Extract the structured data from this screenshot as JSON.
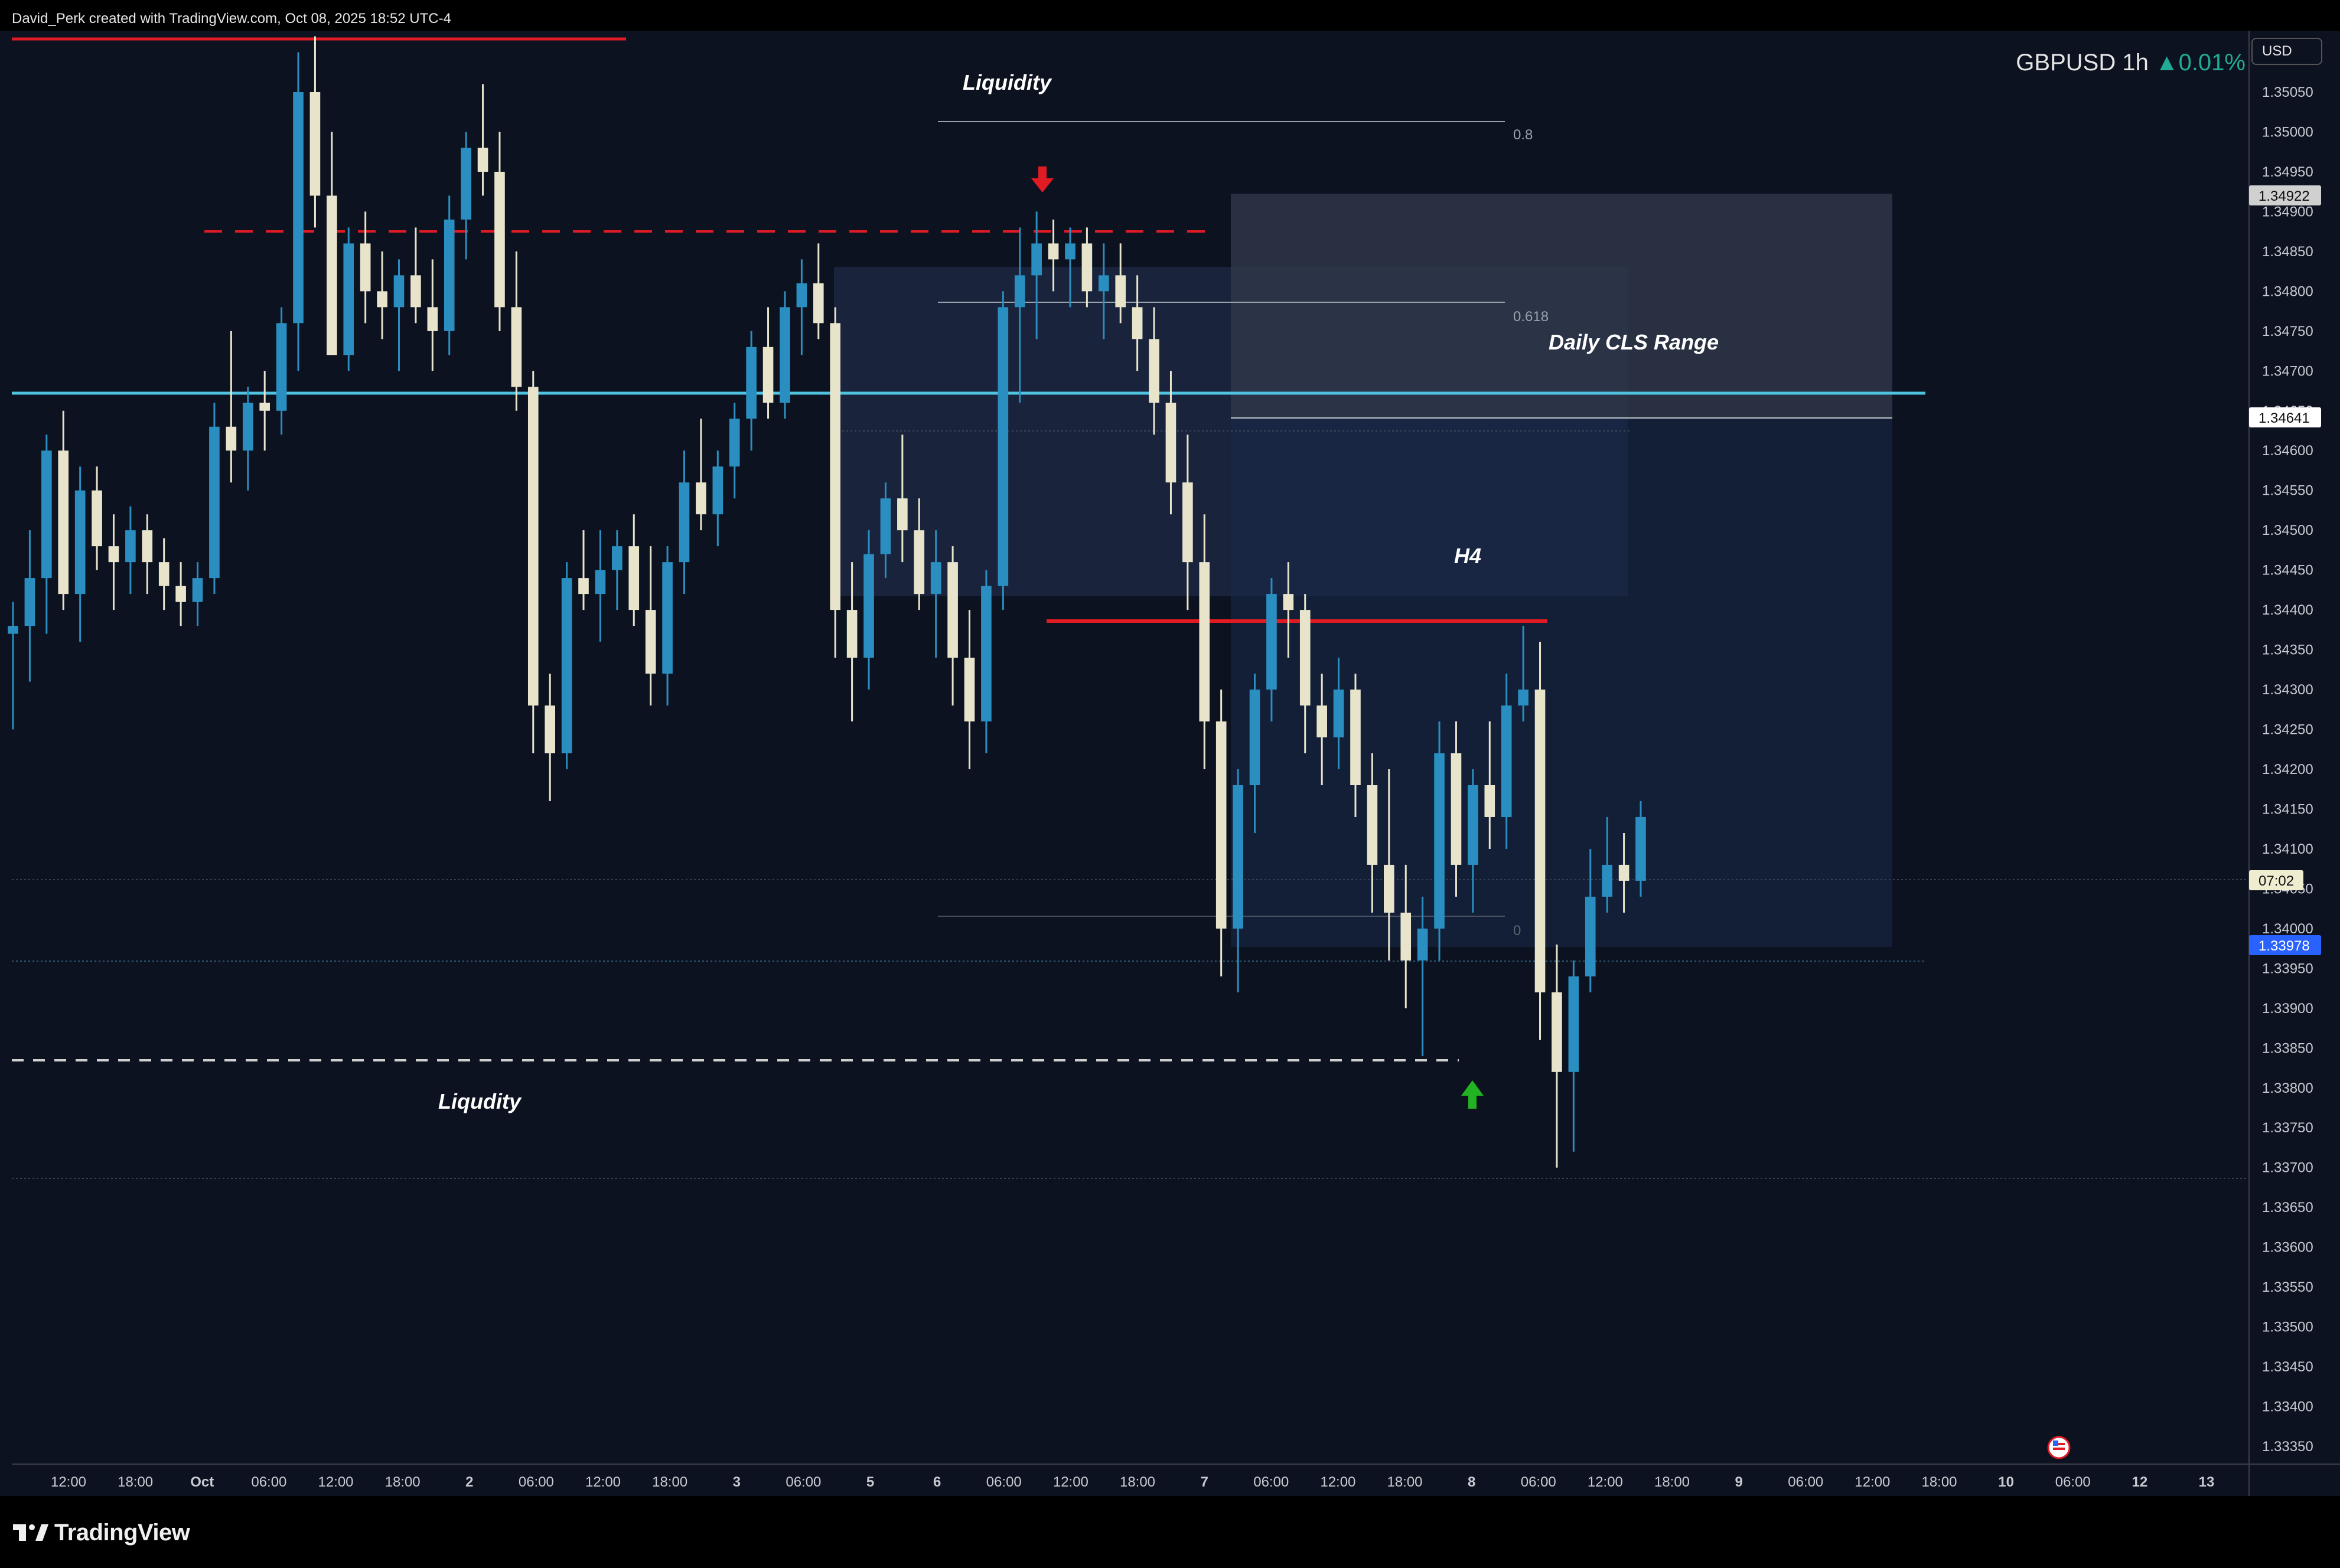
{
  "credit": "David_Perk created with TradingView.com, Oct 08, 2025 18:52 UTC-4",
  "brand": "TradingView",
  "legend": {
    "symbol": "GBPUSD",
    "interval": "1h",
    "change": "▲0.01%"
  },
  "currency": "USD",
  "colors": {
    "background": "#0d1220",
    "up": "#2a8fc0",
    "down": "#e8e4cc",
    "resistance": "#e01b24",
    "level": "#4fc3e0",
    "liquidity_line": "#d0d0d0",
    "arrow_down": "#e01b24",
    "arrow_up": "#22b322"
  },
  "annotations": {
    "liquidity_top": "Liquidity",
    "liquidity_bottom": "Liqudity",
    "daily_range": "Daily CLS Range",
    "h4": "H4",
    "fib_levels": [
      "0.8",
      "0.618",
      "0"
    ]
  },
  "price_tags": {
    "tag_top": "1.34922",
    "tag_mid": "1.34641",
    "countdown": "07:02",
    "last": "1.33978"
  },
  "chart_data": {
    "type": "candlestick",
    "title": "GBPUSD 1h",
    "ylim": [
      1.3332,
      1.3508
    ],
    "yticks": [
      "1.35050",
      "1.35000",
      "1.34950",
      "1.34900",
      "1.34850",
      "1.34800",
      "1.34750",
      "1.34700",
      "1.34650",
      "1.34600",
      "1.34550",
      "1.34500",
      "1.34450",
      "1.34400",
      "1.34350",
      "1.34300",
      "1.34250",
      "1.34200",
      "1.34150",
      "1.34100",
      "1.34050",
      "1.34000",
      "1.33950",
      "1.33900",
      "1.33850",
      "1.33800",
      "1.33750",
      "1.33700",
      "1.33650",
      "1.33600",
      "1.33550",
      "1.33500",
      "1.33450",
      "1.33400",
      "1.33350"
    ],
    "xticks": [
      "12:00",
      "18:00",
      "Oct",
      "06:00",
      "12:00",
      "18:00",
      "2",
      "06:00",
      "12:00",
      "18:00",
      "3",
      "06:00",
      "5",
      "6",
      "06:00",
      "12:00",
      "18:00",
      "7",
      "06:00",
      "12:00",
      "18:00",
      "8",
      "06:00",
      "12:00",
      "18:00",
      "9",
      "06:00",
      "12:00",
      "18:00",
      "10",
      "06:00",
      "12",
      "13"
    ],
    "levels": {
      "resistance_top": 1.3506,
      "cyan_level": 1.3466,
      "h4_red": 1.3439,
      "liquidity_high": 1.3487,
      "liquidity_low": 1.3384
    },
    "candles": [
      [
        1.3437,
        1.3441,
        1.3425,
        1.3438
      ],
      [
        1.3438,
        1.345,
        1.3431,
        1.3444
      ],
      [
        1.3444,
        1.3462,
        1.3437,
        1.346
      ],
      [
        1.346,
        1.3465,
        1.344,
        1.3442
      ],
      [
        1.3442,
        1.3458,
        1.3436,
        1.3455
      ],
      [
        1.3455,
        1.3458,
        1.3445,
        1.3448
      ],
      [
        1.3448,
        1.3452,
        1.344,
        1.3446
      ],
      [
        1.3446,
        1.3453,
        1.3442,
        1.345
      ],
      [
        1.345,
        1.3452,
        1.3442,
        1.3446
      ],
      [
        1.3446,
        1.3449,
        1.344,
        1.3443
      ],
      [
        1.3443,
        1.3446,
        1.3438,
        1.3441
      ],
      [
        1.3441,
        1.3446,
        1.3438,
        1.3444
      ],
      [
        1.3444,
        1.3466,
        1.3442,
        1.3463
      ],
      [
        1.3463,
        1.3475,
        1.3456,
        1.346
      ],
      [
        1.346,
        1.3468,
        1.3455,
        1.3466
      ],
      [
        1.3466,
        1.347,
        1.346,
        1.3465
      ],
      [
        1.3465,
        1.3478,
        1.3462,
        1.3476
      ],
      [
        1.3476,
        1.351,
        1.347,
        1.3505
      ],
      [
        1.3505,
        1.3512,
        1.3488,
        1.3492
      ],
      [
        1.3492,
        1.35,
        1.348,
        1.3472
      ],
      [
        1.3472,
        1.3488,
        1.347,
        1.3486
      ],
      [
        1.3486,
        1.349,
        1.3476,
        1.348
      ],
      [
        1.348,
        1.3485,
        1.3474,
        1.3478
      ],
      [
        1.3478,
        1.3484,
        1.347,
        1.3482
      ],
      [
        1.3482,
        1.3488,
        1.3476,
        1.3478
      ],
      [
        1.3478,
        1.3484,
        1.347,
        1.3475
      ],
      [
        1.3475,
        1.3492,
        1.3472,
        1.3489
      ],
      [
        1.3489,
        1.35,
        1.3484,
        1.3498
      ],
      [
        1.3498,
        1.3506,
        1.3492,
        1.3495
      ],
      [
        1.3495,
        1.35,
        1.3475,
        1.3478
      ],
      [
        1.3478,
        1.3485,
        1.3465,
        1.3468
      ],
      [
        1.3468,
        1.347,
        1.3422,
        1.3428
      ],
      [
        1.3428,
        1.3432,
        1.3416,
        1.3422
      ],
      [
        1.3422,
        1.3446,
        1.342,
        1.3444
      ],
      [
        1.3444,
        1.345,
        1.344,
        1.3442
      ],
      [
        1.3442,
        1.345,
        1.3436,
        1.3445
      ],
      [
        1.3445,
        1.345,
        1.344,
        1.3448
      ],
      [
        1.3448,
        1.3452,
        1.3438,
        1.344
      ],
      [
        1.344,
        1.3448,
        1.3428,
        1.3432
      ],
      [
        1.3432,
        1.3448,
        1.3428,
        1.3446
      ],
      [
        1.3446,
        1.346,
        1.3442,
        1.3456
      ],
      [
        1.3456,
        1.3464,
        1.345,
        1.3452
      ],
      [
        1.3452,
        1.346,
        1.3448,
        1.3458
      ],
      [
        1.3458,
        1.3466,
        1.3454,
        1.3464
      ],
      [
        1.3464,
        1.3475,
        1.346,
        1.3473
      ],
      [
        1.3473,
        1.3478,
        1.3464,
        1.3466
      ],
      [
        1.3466,
        1.348,
        1.3464,
        1.3478
      ],
      [
        1.3478,
        1.3484,
        1.3472,
        1.3481
      ],
      [
        1.3481,
        1.3486,
        1.3474,
        1.3476
      ],
      [
        1.3476,
        1.3478,
        1.3434,
        1.344
      ],
      [
        1.344,
        1.3446,
        1.3426,
        1.3434
      ],
      [
        1.3434,
        1.345,
        1.343,
        1.3447
      ],
      [
        1.3447,
        1.3456,
        1.3444,
        1.3454
      ],
      [
        1.3454,
        1.3462,
        1.3446,
        1.345
      ],
      [
        1.345,
        1.3454,
        1.344,
        1.3442
      ],
      [
        1.3442,
        1.345,
        1.3434,
        1.3446
      ],
      [
        1.3446,
        1.3448,
        1.3428,
        1.3434
      ],
      [
        1.3434,
        1.344,
        1.342,
        1.3426
      ],
      [
        1.3426,
        1.3445,
        1.3422,
        1.3443
      ],
      [
        1.3443,
        1.348,
        1.344,
        1.3478
      ],
      [
        1.3478,
        1.3488,
        1.3466,
        1.3482
      ],
      [
        1.3482,
        1.349,
        1.3474,
        1.3486
      ],
      [
        1.3486,
        1.3489,
        1.348,
        1.3484
      ],
      [
        1.3484,
        1.3488,
        1.3478,
        1.3486
      ],
      [
        1.3486,
        1.3488,
        1.3478,
        1.348
      ],
      [
        1.348,
        1.3486,
        1.3474,
        1.3482
      ],
      [
        1.3482,
        1.3486,
        1.3476,
        1.3478
      ],
      [
        1.3478,
        1.3482,
        1.347,
        1.3474
      ],
      [
        1.3474,
        1.3478,
        1.3462,
        1.3466
      ],
      [
        1.3466,
        1.347,
        1.3452,
        1.3456
      ],
      [
        1.3456,
        1.3462,
        1.344,
        1.3446
      ],
      [
        1.3446,
        1.3452,
        1.342,
        1.3426
      ],
      [
        1.3426,
        1.343,
        1.3394,
        1.34
      ],
      [
        1.34,
        1.342,
        1.3392,
        1.3418
      ],
      [
        1.3418,
        1.3432,
        1.3412,
        1.343
      ],
      [
        1.343,
        1.3444,
        1.3426,
        1.3442
      ],
      [
        1.3442,
        1.3446,
        1.3434,
        1.344
      ],
      [
        1.344,
        1.3442,
        1.3422,
        1.3428
      ],
      [
        1.3428,
        1.3432,
        1.3418,
        1.3424
      ],
      [
        1.3424,
        1.3434,
        1.342,
        1.343
      ],
      [
        1.343,
        1.3432,
        1.3414,
        1.3418
      ],
      [
        1.3418,
        1.3422,
        1.3402,
        1.3408
      ],
      [
        1.3408,
        1.342,
        1.3396,
        1.3402
      ],
      [
        1.3402,
        1.3408,
        1.339,
        1.3396
      ],
      [
        1.3396,
        1.3404,
        1.3384,
        1.34
      ],
      [
        1.34,
        1.3426,
        1.3396,
        1.3422
      ],
      [
        1.3422,
        1.3426,
        1.3404,
        1.3408
      ],
      [
        1.3408,
        1.342,
        1.3402,
        1.3418
      ],
      [
        1.3418,
        1.3426,
        1.341,
        1.3414
      ],
      [
        1.3414,
        1.3432,
        1.341,
        1.3428
      ],
      [
        1.3428,
        1.3438,
        1.3426,
        1.343
      ],
      [
        1.343,
        1.3436,
        1.3386,
        1.3392
      ],
      [
        1.3392,
        1.3398,
        1.337,
        1.3382
      ],
      [
        1.3382,
        1.3396,
        1.3372,
        1.3394
      ],
      [
        1.3394,
        1.341,
        1.3392,
        1.3404
      ],
      [
        1.3404,
        1.3414,
        1.3402,
        1.3408
      ],
      [
        1.3408,
        1.3412,
        1.3402,
        1.3406
      ],
      [
        1.3406,
        1.3416,
        1.3404,
        1.3414
      ]
    ]
  }
}
